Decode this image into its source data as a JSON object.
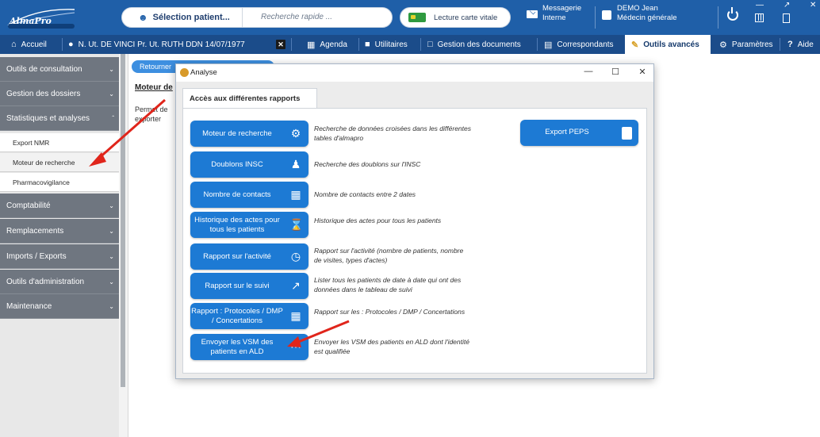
{
  "topbar": {
    "logo": "AlmaPro",
    "patient_selection": "Sélection patient...",
    "quick_search": "Recherche rapide ...",
    "card_reader": "Lecture carte vitale",
    "messaging_line1": "Messagerie",
    "messaging_line2": "Interne",
    "user_line1": "DEMO Jean",
    "user_line2": "Médecin générale"
  },
  "nav": {
    "home": "Accueil",
    "patient": "N. Ut. DE VINCI Pr. Ut. RUTH DDN 14/07/1977",
    "agenda": "Agenda",
    "utilities": "Utilitaires",
    "documents": "Gestion des documents",
    "correspondents": "Correspondants",
    "advanced_tools": "Outils avancés",
    "settings": "Paramètres",
    "help": "Aide"
  },
  "sidebar": {
    "sections": [
      {
        "label": "Outils de consultation"
      },
      {
        "label": "Gestion des dossiers"
      },
      {
        "label": "Statistiques et analyses"
      },
      {
        "label": "Comptabilité"
      },
      {
        "label": "Remplacements"
      },
      {
        "label": "Imports / Exports"
      },
      {
        "label": "Outils d'administration"
      },
      {
        "label": "Maintenance"
      }
    ],
    "subitems": [
      {
        "label": "Export NMR"
      },
      {
        "label": "Moteur de recherche"
      },
      {
        "label": "Pharmacovigilance"
      }
    ]
  },
  "main": {
    "back_button": "Retourner",
    "title": "Moteur de",
    "desc": "Permet de exporter"
  },
  "dialog": {
    "title": "Analyse",
    "tab": "Accès aux différentes rapports",
    "buttons": [
      {
        "label": "Moteur de recherche",
        "desc": "Recherche de données croisées dans les différentes tables d'almapro",
        "icon": "search-db-icon"
      },
      {
        "label": "Doublons INSC",
        "desc": "Recherche des doublons sur l'INSC",
        "icon": "people-icon"
      },
      {
        "label": "Nombre de contacts",
        "desc": "Nombre de contacts entre 2 dates",
        "icon": "calendar-icon"
      },
      {
        "label": "Historique des actes pour tous les patients",
        "desc": "Historique des actes pour tous les patients",
        "icon": "hourglass-icon"
      },
      {
        "label": "Rapport sur l'activité",
        "desc": "Rapport sur l'activité (nombre de patients, nombre de visites, types d'actes)",
        "icon": "report-clock-icon"
      },
      {
        "label": "Rapport sur le suivi",
        "desc": "Lister tous les patients de date à date qui ont des données dans le tableau de suivi",
        "icon": "report-chart-icon"
      },
      {
        "label": "Rapport : Protocoles / DMP / Concertations",
        "desc": "Rapport sur les : Protocoles / DMP / Concertations",
        "icon": "report-grid-icon"
      },
      {
        "label": "Envoyer les VSM des patients en ALD",
        "desc": "Envoyer les VSM des patients en ALD dont l'identité est qualifiée",
        "icon": "send-icon"
      }
    ],
    "export_peps": "Export PEPS"
  }
}
